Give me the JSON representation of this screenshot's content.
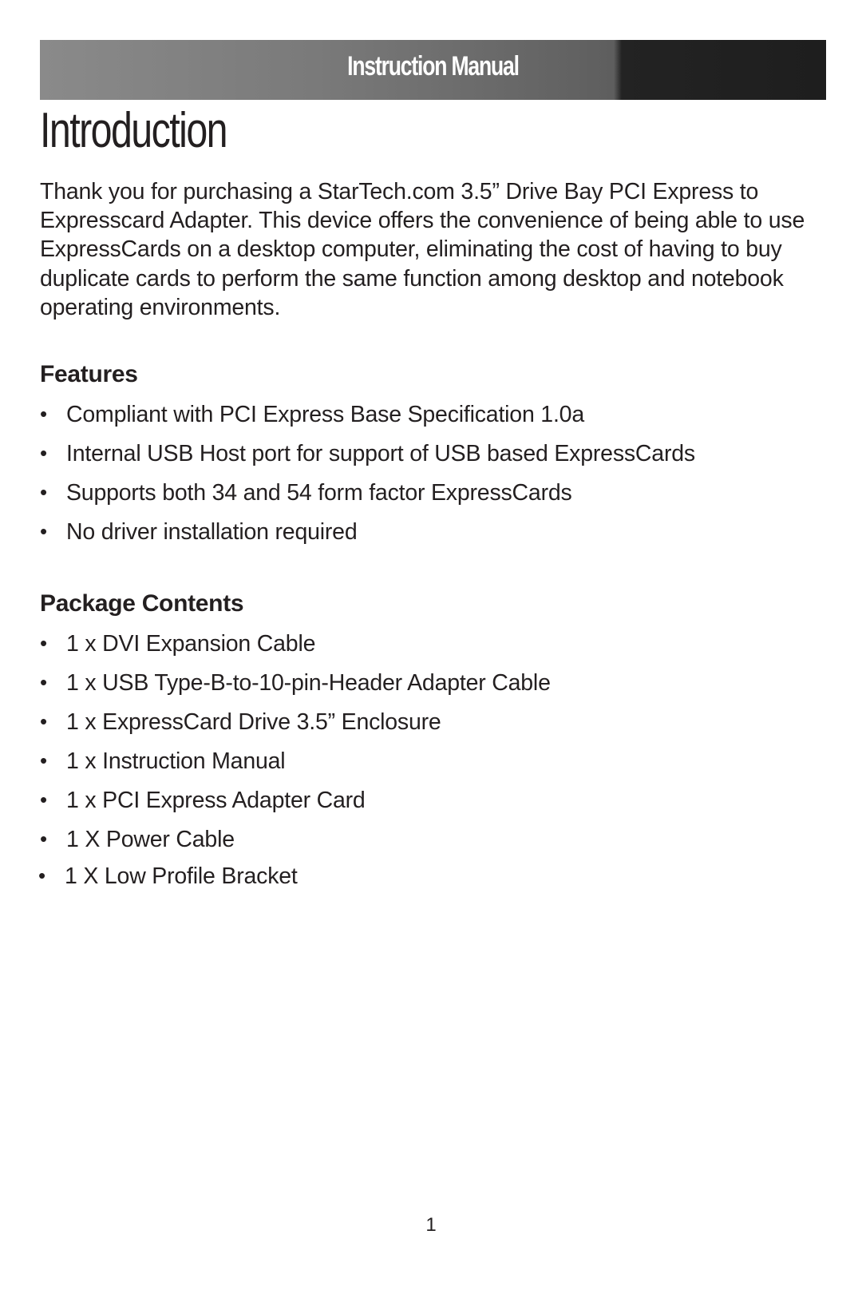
{
  "header": {
    "title": "Instruction Manual",
    "colors": {
      "light": "#8a8a8a",
      "dark": "#1e1e1e",
      "text": "#ffffff"
    }
  },
  "page_title": "Introduction",
  "intro_paragraph": "Thank you for purchasing a StarTech.com 3.5” Drive Bay PCI Express to Expresscard Adapter.  This device offers the convenience of being able to use ExpressCards on a desktop computer, eliminating the cost of having to buy duplicate cards to perform the same function among desktop and notebook operating environments.",
  "features": {
    "heading": "Features",
    "items": [
      "Compliant with PCI Express Base Specification 1.0a",
      "Internal USB Host port for support of USB based ExpressCards",
      "Supports both 34 and 54 form factor ExpressCards",
      "No driver installation required"
    ]
  },
  "package_contents": {
    "heading": "Package Contents",
    "items": [
      "1 x DVI Expansion Cable",
      "1 x USB Type-B-to-10-pin-Header Adapter Cable",
      "1 x ExpressCard Drive 3.5” Enclosure",
      "1 x Instruction Manual",
      "1 x PCI Express Adapter Card",
      "1 X Power Cable",
      "1 X Low Profile Bracket"
    ]
  },
  "bullet_glyph": "•",
  "page_number": "1"
}
